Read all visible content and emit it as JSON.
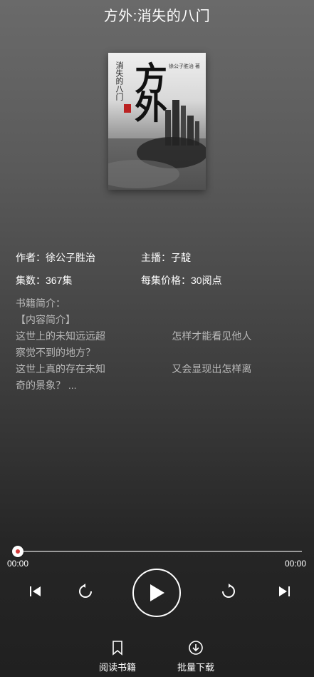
{
  "header": {
    "title": "方外:消失的八门"
  },
  "cover": {
    "big_title": "方外",
    "sub_title": "消失的八门",
    "author_tag": "徐公子胜治 著"
  },
  "meta": {
    "author": "作者：徐公子胜治",
    "narrator": "主播：子靛",
    "episodes": "集数：367集",
    "price": "每集价格：30阅点"
  },
  "intro": {
    "heading": "书籍简介：",
    "line1": "【内容简介】",
    "line2": "这世上的未知远远超                        怎样才能看见他人",
    "line3": "察觉不到的地方？",
    "line4": "这世上真的存在未知                        又会显现出怎样离",
    "line5": "奇的景象？ ..."
  },
  "player": {
    "progress": 0,
    "current_time": "00:00",
    "total_time": "00:00"
  },
  "actions": {
    "read_label": "阅读书籍",
    "download_label": "批量下载"
  },
  "colors": {
    "accent": "#d23a3a"
  }
}
